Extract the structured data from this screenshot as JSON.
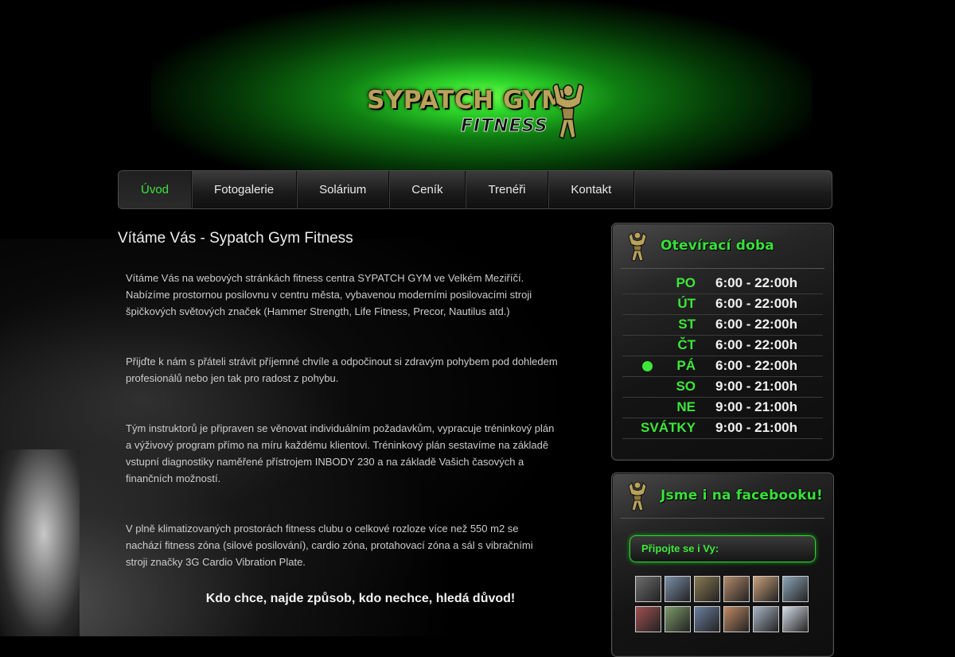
{
  "brand": {
    "logo_main": "SYPATCH GYM",
    "logo_sub": "FITNESS"
  },
  "nav": {
    "items": [
      {
        "label": "Úvod",
        "active": true
      },
      {
        "label": "Fotogalerie"
      },
      {
        "label": "Solárium"
      },
      {
        "label": "Ceník"
      },
      {
        "label": "Trenéři"
      },
      {
        "label": "Kontakt"
      }
    ]
  },
  "main": {
    "title": "Vítáme Vás - Sypatch Gym Fitness",
    "paragraphs": [
      "Vítáme Vás na webových stránkách fitness centra SYPATCH GYM ve Velkém Meziříčí. Nabízíme prostornou posilovnu v centru města, vybavenou moderními posilovacími stroji špičkových světových značek (Hammer Strength, Life Fitness, Precor, Nautilus atd.)",
      "Přijďte k nám s přáteli strávit příjemné chvíle a odpočinout si zdravým pohybem pod dohledem profesionálů nebo jen tak pro radost z pohybu.",
      "Tým instruktorů je připraven se věnovat individuálním požadavkům, vypracuje tréninkový plán a výživový program přímo na míru každému klientovi. Tréninkový plán sestavíme na základě vstupní diagnostiky naměřené přístrojem INBODY 230 a na základě Vašich časových a finančních možností.",
      "V plně klimatizovaných prostorách fitness clubu o celkové rozloze více než 550 m2 se nachází fitness zóna (silové posilování), cardio zóna, protahovací zóna a sál s vibračními stroji značky 3G Cardio Vibration Plate."
    ],
    "quote": "Kdo chce, najde způsob, kdo nechce, hledá důvod!"
  },
  "opening_hours": {
    "title": "Otevírací doba",
    "rows": [
      {
        "day": "PO",
        "time": "6:00 - 22:00h"
      },
      {
        "day": "ÚT",
        "time": "6:00 - 22:00h"
      },
      {
        "day": "ST",
        "time": "6:00 - 22:00h"
      },
      {
        "day": "ČT",
        "time": "6:00 - 22:00h"
      },
      {
        "day": "PÁ",
        "time": "6:00 - 22:00h",
        "today": true
      },
      {
        "day": "SO",
        "time": "9:00 - 21:00h"
      },
      {
        "day": "NE",
        "time": "9:00 - 21:00h"
      },
      {
        "day": "SVÁTKY",
        "time": "9:00 - 21:00h"
      }
    ]
  },
  "facebook": {
    "title": "Jsme i na facebooku!",
    "join_label": "Připojte se i Vy:",
    "thumb_colors": [
      "#6d6d6d",
      "#7b8fa8",
      "#8a7a52",
      "#b38a6a",
      "#c9a07a",
      "#8da6b8",
      "#a05050",
      "#7d9a6a",
      "#6c7fa0",
      "#c08a64",
      "#a8b4c4",
      "#d6dde8"
    ]
  },
  "colors": {
    "accent": "#3ee63a",
    "background": "#000000"
  }
}
